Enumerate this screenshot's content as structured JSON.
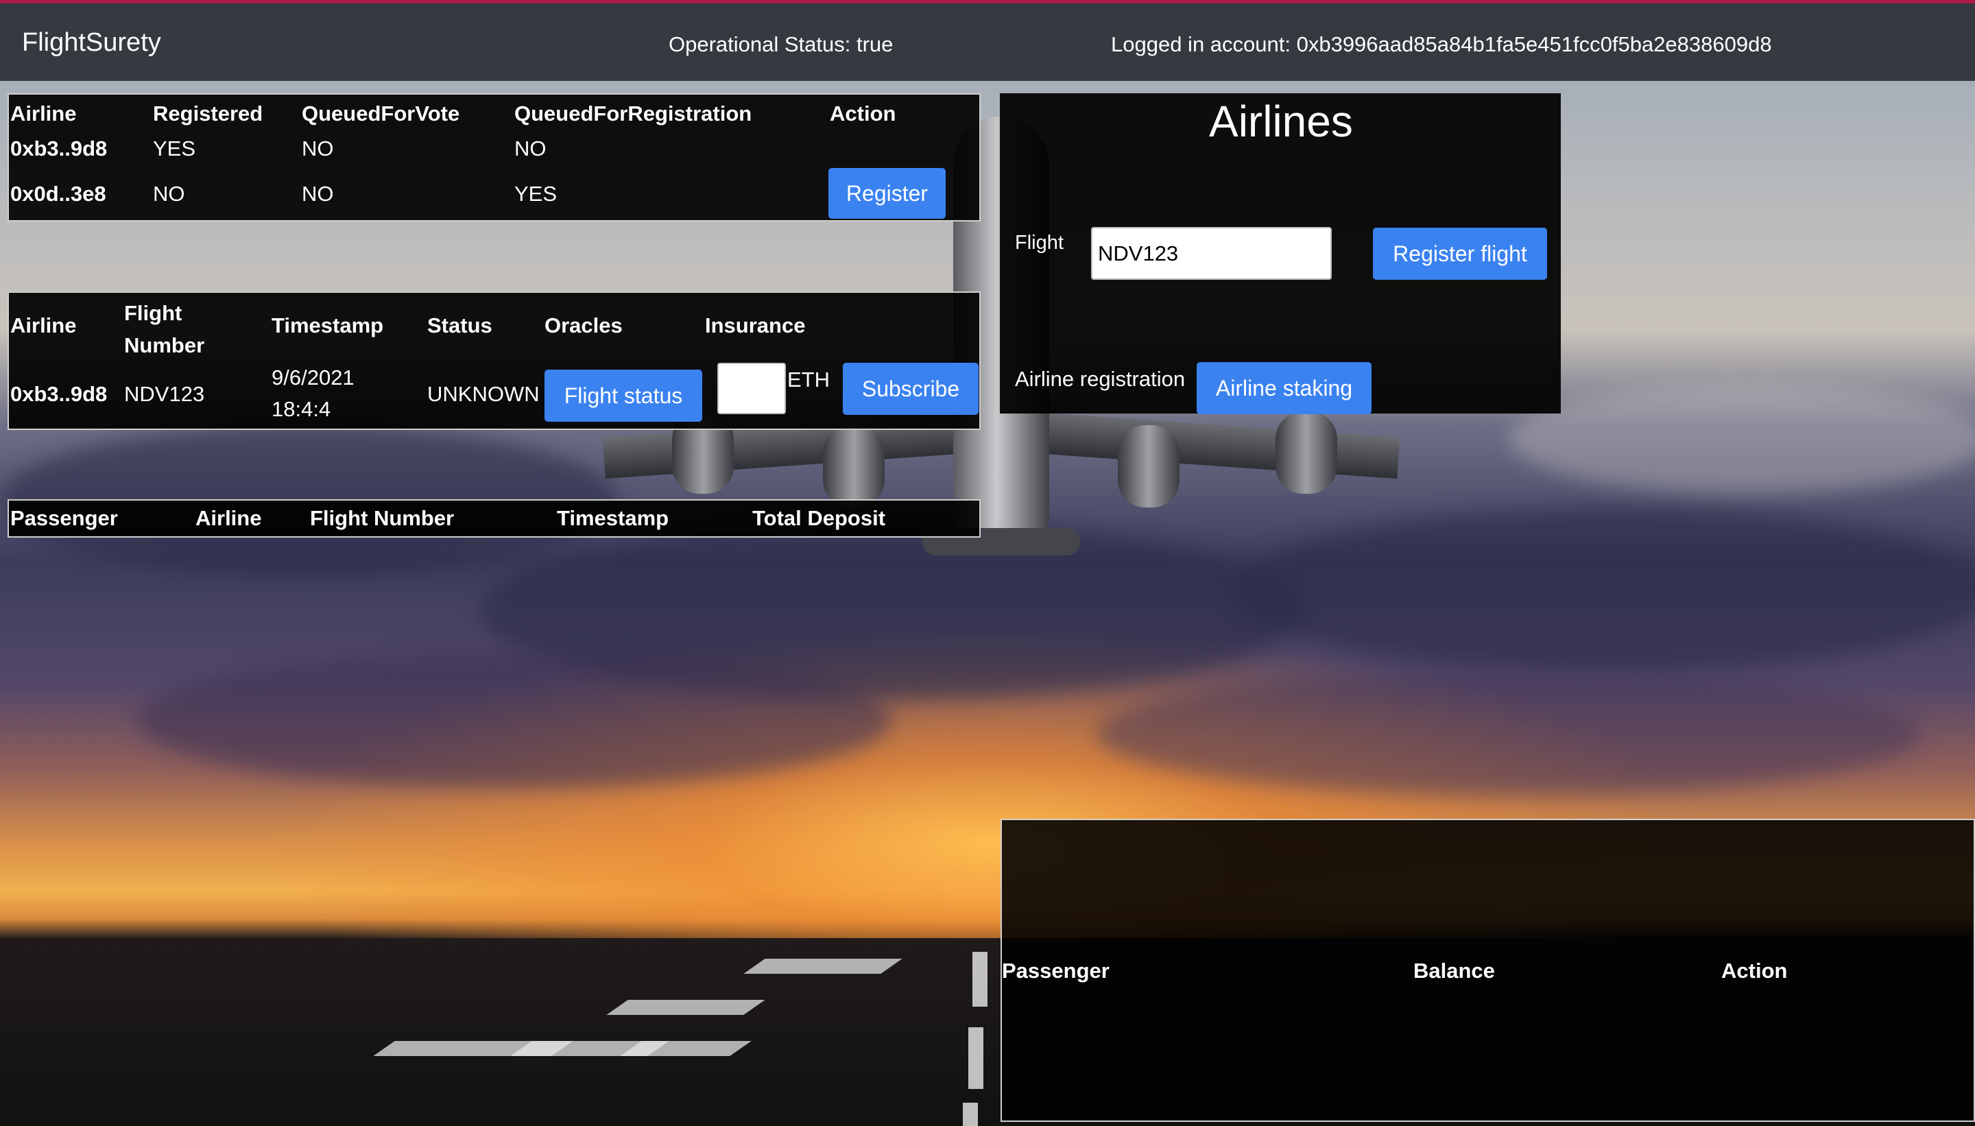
{
  "navbar": {
    "brand": "FlightSurety",
    "operational_status": "Operational Status: true",
    "logged_in": "Logged in account: 0xb3996aad85a84b1fa5e451fcc0f5ba2e838609d8",
    "accent_color": "#b01a4b",
    "bg_color": "#343a40"
  },
  "airlines_table": {
    "headers": [
      "Airline",
      "Registered",
      "QueuedForVote",
      "QueuedForRegistration",
      "Action"
    ],
    "rows": [
      {
        "airline": "0xb3..9d8",
        "registered": "YES",
        "queued_vote": "NO",
        "queued_registration": "NO",
        "action": ""
      },
      {
        "airline": "0x0d..3e8",
        "registered": "NO",
        "queued_vote": "NO",
        "queued_registration": "YES",
        "action": "Register"
      }
    ]
  },
  "flights_table": {
    "headers": [
      "Airline",
      "Flight Number",
      "Timestamp",
      "Status",
      "Oracles",
      "Insurance"
    ],
    "rows": [
      {
        "airline": "0xb3..9d8",
        "flight": "NDV123",
        "timestamp_date": "9/6/2021",
        "timestamp_time": "18:4:4",
        "status": "UNKNOWN",
        "oracles_button": "Flight status",
        "insurance_value": "",
        "insurance_unit": "ETH",
        "subscribe_button": "Subscribe"
      }
    ]
  },
  "insurance_table": {
    "headers": [
      "Passenger",
      "Airline",
      "Flight Number",
      "Timestamp",
      "Total Deposit"
    ]
  },
  "airlines_panel": {
    "title": "Airlines",
    "flight_label": "Flight",
    "flight_value": "NDV123",
    "register_flight_button": "Register flight",
    "airline_registration_label": "Airline registration",
    "airline_staking_button": "Airline staking"
  },
  "passengers_table": {
    "headers": [
      "Passenger",
      "Balance",
      "Action"
    ]
  },
  "colors": {
    "button_blue": "#3b82f1",
    "panel_bg": "#000000"
  }
}
